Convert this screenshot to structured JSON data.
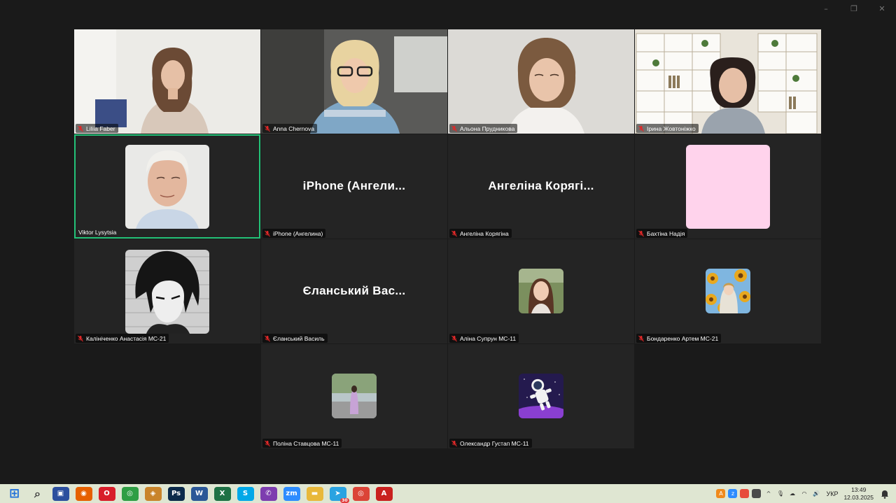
{
  "window_controls": [
    "–",
    "❐",
    "✕"
  ],
  "participants": [
    {
      "name": "Liliia Faber",
      "muted": true,
      "kind": "video",
      "video": "woman-long-hair"
    },
    {
      "name": "Anna Chernova",
      "muted": true,
      "kind": "video",
      "video": "woman-glasses"
    },
    {
      "name": "Альона Прудникова",
      "muted": true,
      "kind": "video",
      "video": "woman-white-shirt"
    },
    {
      "name": "Ірина Жовтоніжко",
      "muted": true,
      "kind": "video",
      "video": "woman-bookshelf"
    },
    {
      "name": "Viktor Lysytsia",
      "muted": false,
      "kind": "avatar",
      "avatar": "elderly-man-photo",
      "active_speaker": true
    },
    {
      "name": "iPhone (Ангелина)",
      "muted": true,
      "kind": "name",
      "display": "iPhone  (Ангели..."
    },
    {
      "name": "Ангеліна Корягіна",
      "muted": true,
      "kind": "name",
      "display": "Ангеліна  Корягі..."
    },
    {
      "name": "Бахтіна Надія",
      "muted": true,
      "kind": "avatar",
      "avatar": "pink-square",
      "accent": "#ffd3ec"
    },
    {
      "name": "Калініченко Анастасія МС-21",
      "muted": true,
      "kind": "avatar",
      "avatar": "anime-manga-portrait"
    },
    {
      "name": "Єланський Василь",
      "muted": true,
      "kind": "name",
      "display": "Єланський  Вас..."
    },
    {
      "name": "Аліна Супрун МС-11",
      "muted": true,
      "kind": "avatar-small",
      "avatar": "girl-photo"
    },
    {
      "name": "Бондаренко Артем МС-21",
      "muted": true,
      "kind": "avatar-small",
      "avatar": "sunflower-art"
    },
    {
      "name": "Поліна Ставцова МС-11",
      "muted": true,
      "kind": "avatar-small",
      "avatar": "girl-outdoor-photo"
    },
    {
      "name": "Олександр Густап МС-11",
      "muted": true,
      "kind": "avatar-small",
      "avatar": "astronaut-art"
    }
  ],
  "taskbar": {
    "apps": [
      {
        "name": "windows-start-icon",
        "glyph": "⊞",
        "color": "#1e6fd9"
      },
      {
        "name": "search-icon",
        "glyph": "⌕",
        "color": "#3a3a3a"
      },
      {
        "name": "save-icon",
        "glyph": "▣",
        "color": "#2c4f9e"
      },
      {
        "name": "firefox-icon",
        "glyph": "◉",
        "color": "#e66000"
      },
      {
        "name": "opera-icon",
        "glyph": "O",
        "color": "#d81e2a"
      },
      {
        "name": "chrome-icon",
        "glyph": "◎",
        "color": "#2f9e44"
      },
      {
        "name": "eye-app-icon",
        "glyph": "◈",
        "color": "#c9842b"
      },
      {
        "name": "photoshop-icon",
        "glyph": "Ps",
        "color": "#0b2a4a"
      },
      {
        "name": "word-icon",
        "glyph": "W",
        "color": "#2b5797"
      },
      {
        "name": "excel-icon",
        "glyph": "X",
        "color": "#1e7145"
      },
      {
        "name": "skype-icon",
        "glyph": "S",
        "color": "#00a8e8"
      },
      {
        "name": "viber-icon",
        "glyph": "✆",
        "color": "#7d3daf"
      },
      {
        "name": "zoom-icon",
        "glyph": "zm",
        "color": "#2d8cff"
      },
      {
        "name": "file-explorer-icon",
        "glyph": "▬",
        "color": "#e8b83a"
      },
      {
        "name": "telegram-icon",
        "glyph": "➤",
        "color": "#2aa3e1"
      },
      {
        "name": "chrome2-icon",
        "glyph": "◎",
        "color": "#db4437"
      },
      {
        "name": "pdf-icon",
        "glyph": "A",
        "color": "#c9211e"
      }
    ],
    "telegram_badge": "30",
    "tray_icons": [
      "avast-icon",
      "zoom-tray-icon",
      "tray-app-icon",
      "tray-app2-icon",
      "chevron-up-icon",
      "mic-icon",
      "onedrive-icon",
      "wifi-icon",
      "volume-icon"
    ],
    "language": "УКР",
    "time": "13:49",
    "date": "12.03.2025"
  }
}
